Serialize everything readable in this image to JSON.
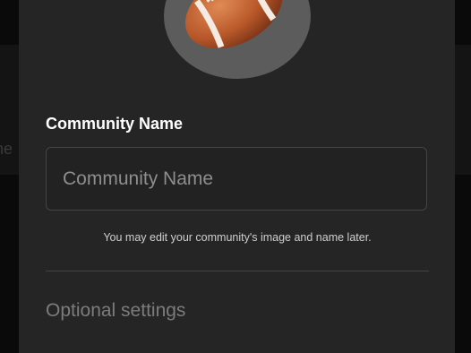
{
  "backdrop": {
    "partial_text": "ne"
  },
  "modal": {
    "avatar_icon": "football-icon",
    "name_field": {
      "label": "Community Name",
      "value": "",
      "placeholder": "Community Name"
    },
    "hint": "You may edit your community's image and name later.",
    "optional_settings_label": "Optional settings"
  },
  "colors": {
    "modal_bg": "#252525",
    "avatar_ring": "#5c5c5c",
    "input_border": "#444444"
  }
}
